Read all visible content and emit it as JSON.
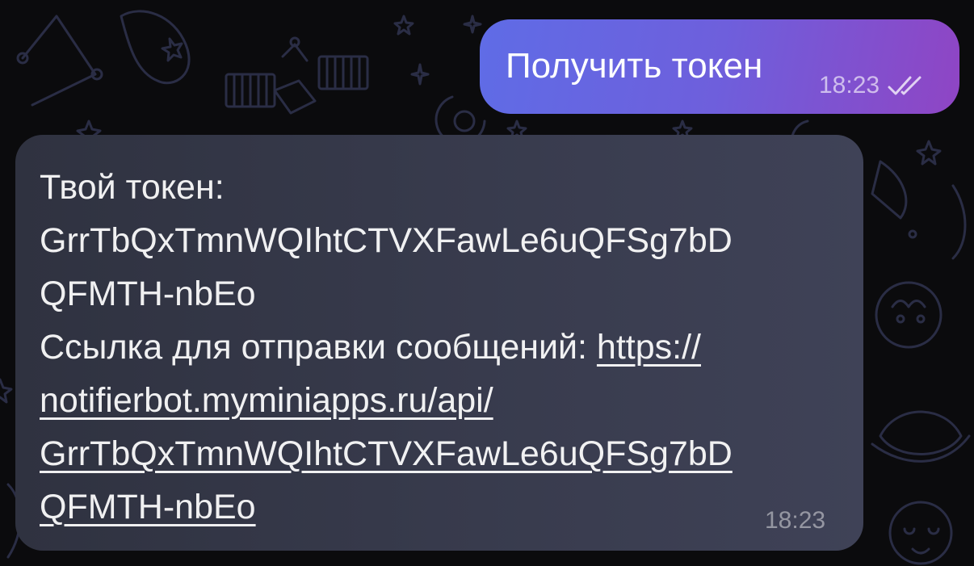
{
  "outgoing_message": {
    "text": "Получить токен",
    "time": "18:23",
    "status_icon": "double-check-icon"
  },
  "incoming_message": {
    "token_label": "Твой токен:",
    "token_line_1": "GrrTbQxTmnWQIhtCTVXFawLe6uQFSg7bD",
    "token_line_2": "QFMTH-nbEo",
    "link_label": "Ссылка для отправки сообщений:",
    "link_part_1": "https://",
    "link_part_2": "notifierbot.myminiapps.ru/api/",
    "link_part_3": "GrrTbQxTmnWQIhtCTVXFawLe6uQFSg7bD",
    "link_part_4": "QFMTH-nbEo",
    "time": "18:23"
  },
  "colors": {
    "background": "#0b0b0d",
    "outgoing_gradient_start": "#5f6ce6",
    "outgoing_gradient_end": "#8f45c4",
    "incoming_bubble": "#383b4d",
    "doodle_stroke": "#2a2d45"
  }
}
